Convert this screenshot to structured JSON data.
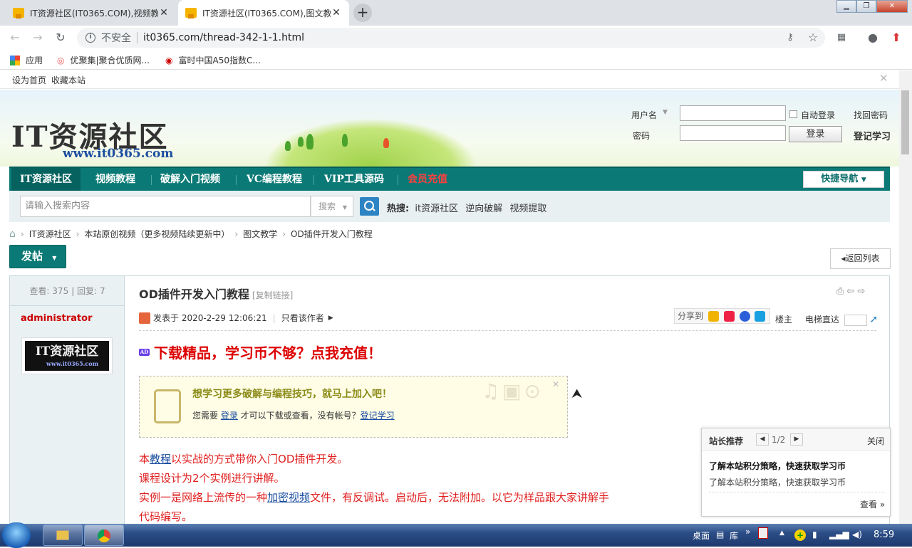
{
  "browser": {
    "tabs": [
      {
        "title": "IT资源社区(IT0365.COM),视频教"
      },
      {
        "title": "IT资源社区(IT0365.COM),图文教"
      }
    ],
    "insecure_label": "不安全",
    "url": "it0365.com/thread-342-1-1.html",
    "bookmarks": [
      {
        "label": "应用"
      },
      {
        "label": "优聚集|聚合优质网..."
      },
      {
        "label": "富时中国A50指数C..."
      }
    ]
  },
  "site": {
    "topbar": {
      "home": "设为首页",
      "fav": "收藏本站"
    },
    "logo": "IT资源社区",
    "logo_url": "www.it0365.com",
    "login": {
      "username_label": "用户名",
      "password_label": "密码",
      "auto_login": "自动登录",
      "forgot": "找回密码",
      "login_btn": "登录",
      "register": "登记学习"
    },
    "nav": [
      "IT资源社区",
      "视频教程",
      "破解入门视频",
      "VC编程教程",
      "VIP工具源码",
      "会员充值"
    ],
    "quicknav": "快捷导航",
    "search": {
      "placeholder": "请输入搜索内容",
      "select": "搜索",
      "hot_label": "热搜:",
      "hot": [
        "it资源社区",
        "逆向破解",
        "视频提取"
      ]
    },
    "breadcrumb": [
      "IT资源社区",
      "本站原创视频（更多视频陆续更新中）",
      "图文教学",
      "OD插件开发入门教程"
    ],
    "post_btn": "发帖",
    "back_btn": "返回列表"
  },
  "thread": {
    "stats": {
      "views_label": "查看:",
      "views": "375",
      "replies_label": "回复:",
      "replies": "7"
    },
    "author": "administrator",
    "avatar_text": "IT资源社区",
    "avatar_url": "www.it0365.com",
    "title": "OD插件开发入门教程",
    "copy_link": "[复制链接]",
    "posted": "发表于 2020-2-29 12:06:21",
    "only_author": "只看该作者",
    "share": "分享到",
    "floor": "楼主",
    "elevator": "电梯直达",
    "promo": "下载精品，学习币不够？点我充值！",
    "lock": {
      "title": "想学习更多破解与编程技巧，就马上加入吧！",
      "pre": "您需要 ",
      "login": "登录",
      "mid": " 才可以下载或查看，没有帐号？",
      "reg": "登记学习"
    },
    "body": [
      {
        "pre": "本",
        "u": "教程",
        "post": "以实战的方式带你入门OD插件开发。"
      },
      {
        "pre": "课程设计为2个实例进行讲解。",
        "u": "",
        "post": ""
      },
      {
        "pre": "实例一是网络上流传的一种",
        "u": "加密视频",
        "post": "文件，有反调试。启动后，无法附加。以它为样品跟大家讲解手"
      },
      {
        "pre": "代码编写。",
        "u": "",
        "post": ""
      }
    ]
  },
  "tip": {
    "head": "站长推荐",
    "page": "1/2",
    "close": "关闭",
    "title": "了解本站积分策略，快速获取学习币",
    "desc": "了解本站积分策略，快速获取学习币",
    "more": "查看 »"
  },
  "taskbar": {
    "desktop": "桌面",
    "lib": "库",
    "time": "8:59"
  }
}
